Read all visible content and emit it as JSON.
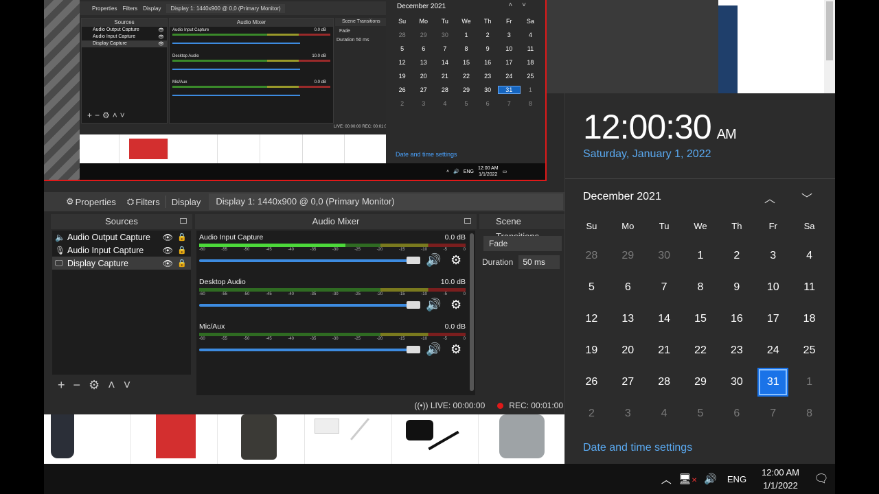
{
  "preview": {
    "toolbar": {
      "properties": "Properties",
      "filters": "Filters",
      "display": "Display",
      "display_value": "Display 1: 1440x900 @ 0,0 (Primary Monitor)"
    },
    "sources_title": "Sources",
    "sources": [
      "Audio Output Capture",
      "Audio Input Capture",
      "Display Capture"
    ],
    "mixer_title": "Audio Mixer",
    "channels": [
      {
        "name": "Audio Input Capture",
        "db": "0.0 dB"
      },
      {
        "name": "Desktop Audio",
        "db": "10.0 dB"
      },
      {
        "name": "Mic/Aux",
        "db": "0.0 dB"
      }
    ],
    "transitions_title": "Scene Transitions",
    "fade": "Fade",
    "duration_label": "Duration",
    "duration_value": "50 ms",
    "status": "LIVE: 00:00:00    REC: 00:01:0",
    "calendar": {
      "month": "December 2021",
      "weekdays": [
        "Su",
        "Mo",
        "Tu",
        "We",
        "Th",
        "Fr",
        "Sa"
      ],
      "days": [
        "28",
        "29",
        "30",
        "1",
        "2",
        "3",
        "4",
        "5",
        "6",
        "7",
        "8",
        "9",
        "10",
        "11",
        "12",
        "13",
        "14",
        "15",
        "16",
        "17",
        "18",
        "19",
        "20",
        "21",
        "22",
        "23",
        "24",
        "25",
        "26",
        "27",
        "28",
        "29",
        "30",
        "31",
        "1",
        "2",
        "3",
        "4",
        "5",
        "6",
        "7",
        "8"
      ],
      "settings": "Date and time settings"
    },
    "tray": {
      "lang": "ENG",
      "time": "12:00 AM",
      "date": "1/1/2022"
    }
  },
  "obs": {
    "toolbar": {
      "properties": "Properties",
      "filters": "Filters",
      "display": "Display",
      "display_value": "Display 1: 1440x900 @ 0,0 (Primary Monitor)"
    },
    "sources": {
      "title": "Sources",
      "items": [
        {
          "label": "Audio Output Capture",
          "icon": "speaker-icon"
        },
        {
          "label": "Audio Input Capture",
          "icon": "microphone-icon"
        },
        {
          "label": "Display Capture",
          "icon": "monitor-icon"
        }
      ]
    },
    "mixer": {
      "title": "Audio Mixer",
      "ticks": [
        "-60",
        "-55",
        "-50",
        "-45",
        "-40",
        "-35",
        "-30",
        "-25",
        "-20",
        "-15",
        "-10",
        "-5",
        "0"
      ],
      "channels": [
        {
          "name": "Audio Input Capture",
          "db": "0.0 dB",
          "level": 0.55
        },
        {
          "name": "Desktop Audio",
          "db": "10.0 dB",
          "level": 0
        },
        {
          "name": "Mic/Aux",
          "db": "0.0 dB",
          "level": 0
        }
      ]
    },
    "transitions": {
      "title": "Scene Transitions",
      "type": "Fade",
      "duration_label": "Duration",
      "duration_value": "50 ms"
    },
    "status": {
      "live": "LIVE: 00:00:00",
      "rec": "REC: 00:01:00"
    }
  },
  "flyout": {
    "time": "12:00:30",
    "ampm": "AM",
    "date": "Saturday, January 1, 2022",
    "month": "December 2021",
    "weekdays": [
      "Su",
      "Mo",
      "Tu",
      "We",
      "Th",
      "Fr",
      "Sa"
    ],
    "days": [
      {
        "n": "28",
        "dim": true
      },
      {
        "n": "29",
        "dim": true
      },
      {
        "n": "30",
        "dim": true
      },
      {
        "n": "1"
      },
      {
        "n": "2"
      },
      {
        "n": "3"
      },
      {
        "n": "4"
      },
      {
        "n": "5"
      },
      {
        "n": "6"
      },
      {
        "n": "7"
      },
      {
        "n": "8"
      },
      {
        "n": "9"
      },
      {
        "n": "10"
      },
      {
        "n": "11"
      },
      {
        "n": "12"
      },
      {
        "n": "13"
      },
      {
        "n": "14"
      },
      {
        "n": "15"
      },
      {
        "n": "16"
      },
      {
        "n": "17"
      },
      {
        "n": "18"
      },
      {
        "n": "19"
      },
      {
        "n": "20"
      },
      {
        "n": "21"
      },
      {
        "n": "22"
      },
      {
        "n": "23"
      },
      {
        "n": "24"
      },
      {
        "n": "25"
      },
      {
        "n": "26"
      },
      {
        "n": "27"
      },
      {
        "n": "28"
      },
      {
        "n": "29"
      },
      {
        "n": "30"
      },
      {
        "n": "31",
        "sel": true
      },
      {
        "n": "1",
        "dim": true
      },
      {
        "n": "2",
        "dim": true
      },
      {
        "n": "3",
        "dim": true
      },
      {
        "n": "4",
        "dim": true
      },
      {
        "n": "5",
        "dim": true
      },
      {
        "n": "6",
        "dim": true
      },
      {
        "n": "7",
        "dim": true
      },
      {
        "n": "8",
        "dim": true
      }
    ],
    "settings": "Date and time settings"
  },
  "taskbar": {
    "lang": "ENG",
    "time": "12:00 AM",
    "date": "1/1/2022"
  }
}
